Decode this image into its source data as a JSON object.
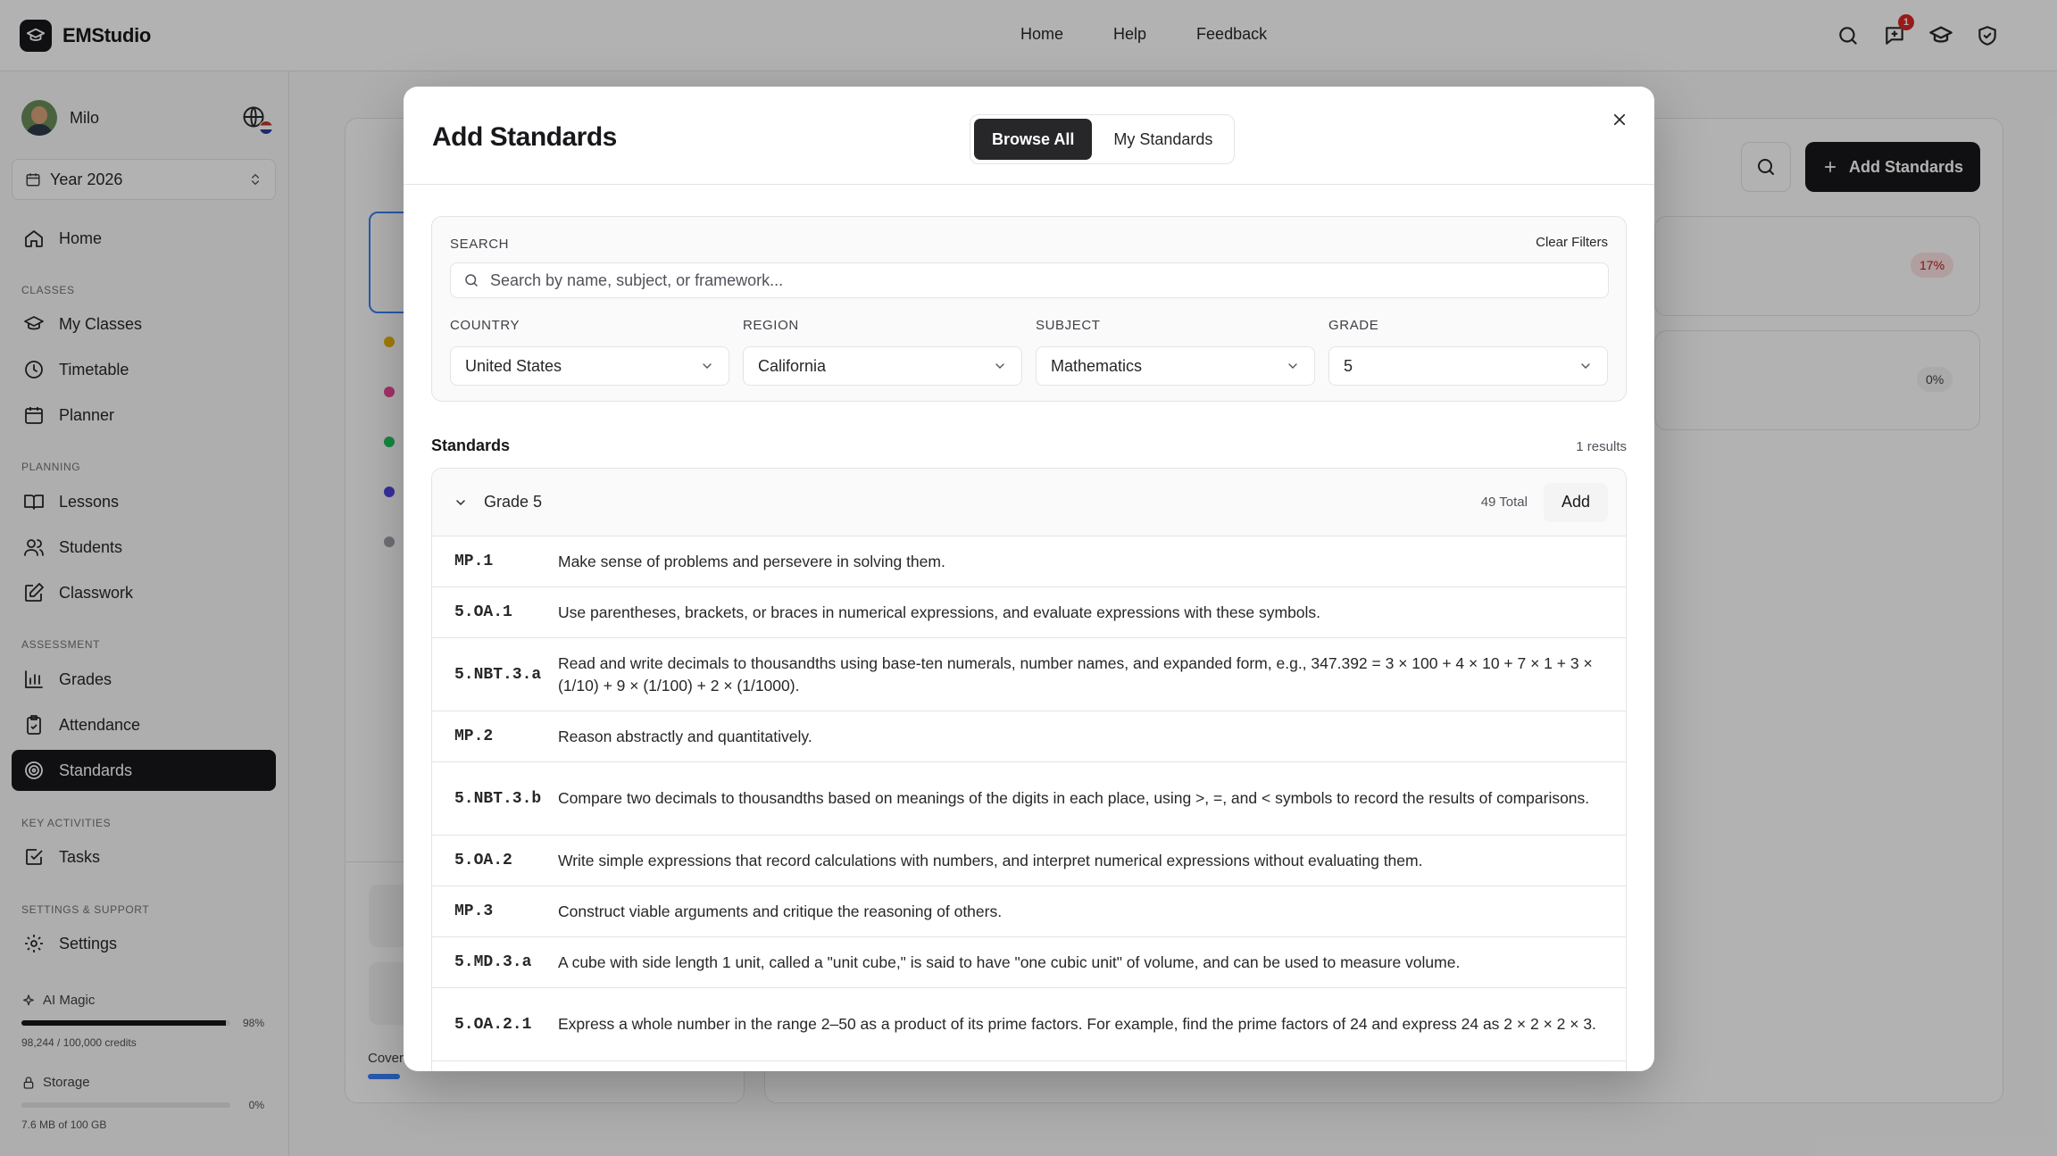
{
  "app": {
    "name": "EMStudio"
  },
  "topnav": {
    "home": "Home",
    "help": "Help",
    "feedback": "Feedback"
  },
  "notifications": {
    "count": "1"
  },
  "user": {
    "name": "Milo"
  },
  "year_select": {
    "value": "Year 2026"
  },
  "sidebar": {
    "home": "Home",
    "sections": {
      "classes": "CLASSES",
      "planning": "PLANNING",
      "assessment": "ASSESSMENT",
      "key_activities": "KEY ACTIVITIES",
      "settings_support": "SETTINGS & SUPPORT"
    },
    "items": {
      "my_classes": "My Classes",
      "timetable": "Timetable",
      "planner": "Planner",
      "lessons": "Lessons",
      "students": "Students",
      "classwork": "Classwork",
      "grades": "Grades",
      "attendance": "Attendance",
      "standards": "Standards",
      "tasks": "Tasks",
      "settings": "Settings"
    },
    "ai_magic": {
      "label": "AI Magic",
      "percent": "98%",
      "fraction": 0.98,
      "credits": "98,244 / 100,000 credits"
    },
    "storage": {
      "label": "Storage",
      "percent": "0%",
      "fraction": 0.0,
      "usage": "7.6 MB of 100 GB"
    }
  },
  "background": {
    "add_standards": "Add Standards",
    "pct_1": "17%",
    "pct_2": "0%",
    "cover_text": "Cover"
  },
  "modal": {
    "title": "Add Standards",
    "tabs": {
      "browse_all": "Browse All",
      "my_standards": "My Standards"
    },
    "filters": {
      "search_label": "SEARCH",
      "clear": "Clear Filters",
      "search_placeholder": "Search by name, subject, or framework...",
      "search_value": "",
      "country": {
        "label": "COUNTRY",
        "value": "United States"
      },
      "region": {
        "label": "REGION",
        "value": "California"
      },
      "subject": {
        "label": "SUBJECT",
        "value": "Mathematics"
      },
      "grade": {
        "label": "GRADE",
        "value": "5"
      }
    },
    "standards_heading": "Standards",
    "results_count": "1 results",
    "group": {
      "title": "Grade 5",
      "total": "49 Total",
      "add_label": "Add"
    },
    "rows": [
      {
        "code": "MP.1",
        "desc": "Make sense of problems and persevere in solving them."
      },
      {
        "code": "5.OA.1",
        "desc": "Use parentheses, brackets, or braces in numerical expressions, and evaluate expressions with these symbols."
      },
      {
        "code": "5.NBT.3.a",
        "desc": "Read and write decimals to thousandths using base-ten numerals, number names, and expanded form, e.g., 347.392 = 3 × 100 + 4 × 10 + 7 × 1 + 3 × (1/10) + 9 × (1/100) + 2 × (1/1000)."
      },
      {
        "code": "MP.2",
        "desc": "Reason abstractly and quantitatively."
      },
      {
        "code": "5.NBT.3.b",
        "desc": "Compare two decimals to thousandths based on meanings of the digits in each place, using >, =, and < symbols to record the results of comparisons."
      },
      {
        "code": "5.OA.2",
        "desc": "Write simple expressions that record calculations with numbers, and interpret numerical expressions without evaluating them."
      },
      {
        "code": "MP.3",
        "desc": "Construct viable arguments and critique the reasoning of others."
      },
      {
        "code": "5.MD.3.a",
        "desc": "A cube with side length 1 unit, called a \"unit cube,\" is said to have \"one cubic unit\" of volume, and can be used to measure volume."
      },
      {
        "code": "5.OA.2.1",
        "desc": "Express a whole number in the range 2–50 as a product of its prime factors. For example, find the prime factors of 24 and express 24 as 2 × 2 × 2 × 3."
      }
    ]
  }
}
